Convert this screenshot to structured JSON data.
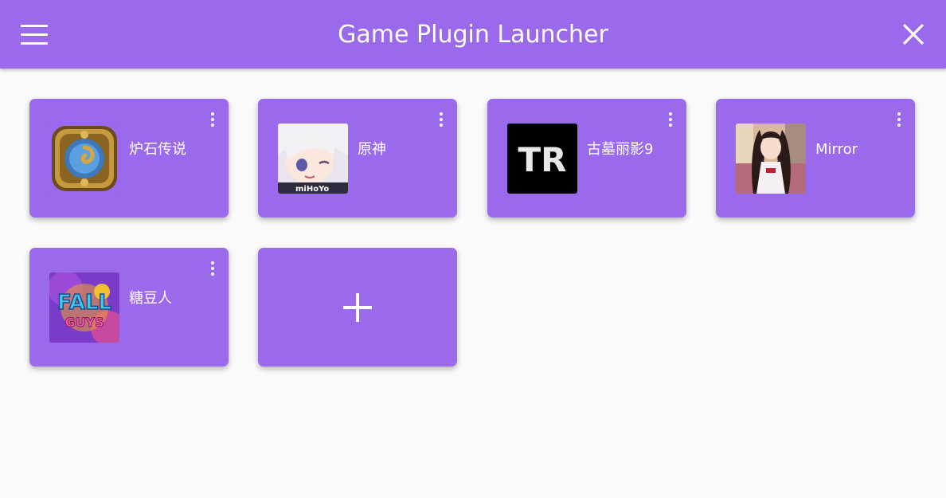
{
  "app": {
    "title": "Game Plugin Launcher"
  },
  "colors": {
    "primary": "#9b69eb",
    "background": "#fafafa",
    "text_on_primary": "#ffffff"
  },
  "games": [
    {
      "name": "炉石传说",
      "icon": "hearthstone-icon"
    },
    {
      "name": "原神",
      "icon": "genshin-icon"
    },
    {
      "name": "古墓丽影9",
      "icon": "tomb-raider-icon"
    },
    {
      "name": "Mirror",
      "icon": "mirror-icon"
    },
    {
      "name": "糖豆人",
      "icon": "fall-guys-icon"
    }
  ],
  "icons": {
    "menu": "menu-icon",
    "close": "close-icon",
    "more": "more-vert-icon",
    "add": "plus-icon",
    "tomb_raider_text": "TR",
    "genshin_logo_text": "miHoYo",
    "fall_guys_text_1": "FALL",
    "fall_guys_text_2": "GUYS"
  }
}
